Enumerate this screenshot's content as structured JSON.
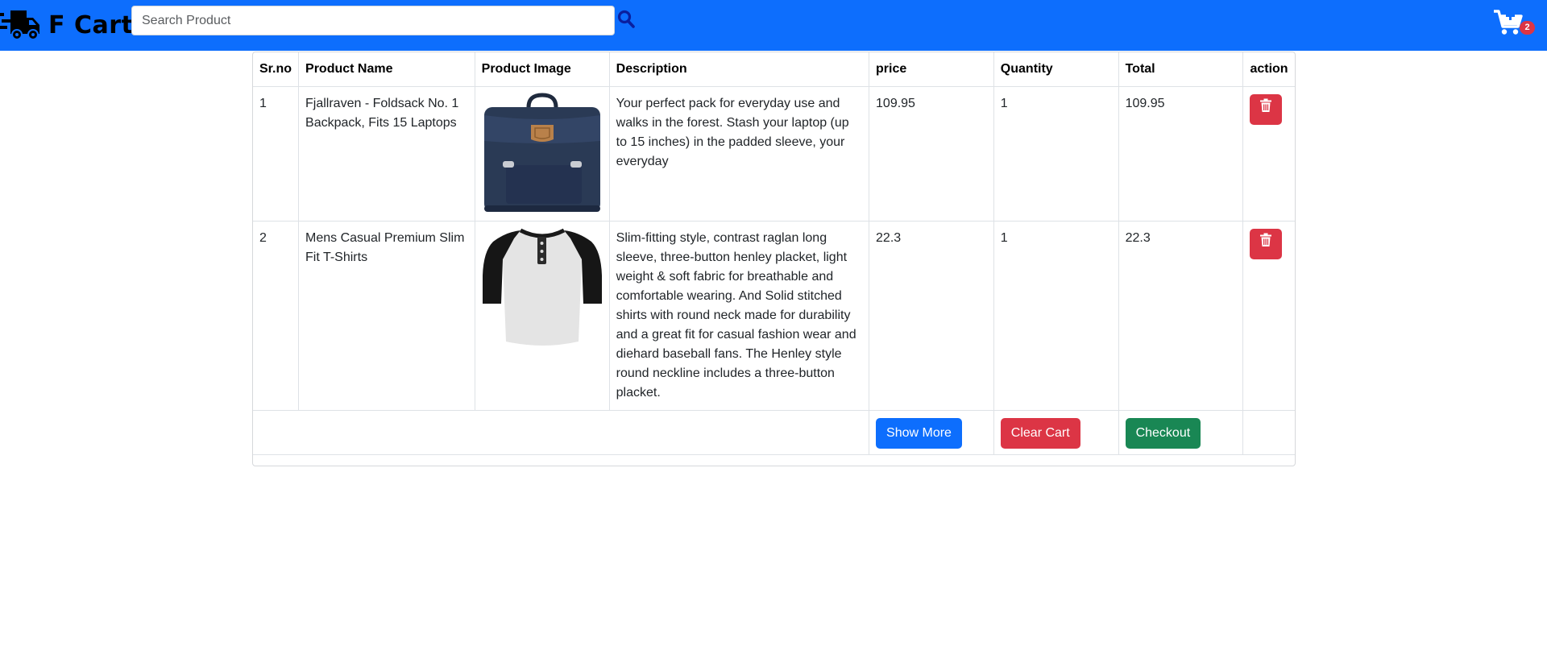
{
  "navbar": {
    "brand_icon": "truck-icon",
    "brand_text": "F Cart",
    "search_placeholder": "Search Product",
    "search_icon": "search-icon",
    "cart_icon": "cart-plus-icon",
    "cart_count": "2",
    "color": "#0d6efd"
  },
  "table": {
    "headers": [
      "Sr.no",
      "Product Name",
      "Product Image",
      "Description",
      "price",
      "Quantity",
      "Total",
      "action"
    ],
    "rows": [
      {
        "sr": "1",
        "name": "Fjallraven - Foldsack No. 1 Backpack, Fits 15 Laptops",
        "image": "navy-backpack-image",
        "description": "Your perfect pack for everyday use and walks in the forest. Stash your laptop (up to 15 inches) in the padded sleeve, your everyday",
        "price": "109.95",
        "quantity": "1",
        "total": "109.95",
        "action_icon": "trash-icon"
      },
      {
        "sr": "2",
        "name": "Mens Casual Premium Slim Fit T-Shirts",
        "image": "raglan-tshirt-image",
        "description": "Slim-fitting style, contrast raglan long sleeve, three-button henley placket, light weight & soft fabric for breathable and comfortable wearing. And Solid stitched shirts with round neck made for durability and a great fit for casual fashion wear and diehard baseball fans. The Henley style round neckline includes a three-button placket.",
        "price": "22.3",
        "quantity": "1",
        "total": "22.3",
        "action_icon": "trash-icon"
      }
    ],
    "footer": {
      "show_more_label": "Show More",
      "clear_cart_label": "Clear Cart",
      "checkout_label": "Checkout"
    }
  },
  "colors": {
    "primary": "#0d6efd",
    "danger": "#dc3545",
    "success": "#198754"
  }
}
